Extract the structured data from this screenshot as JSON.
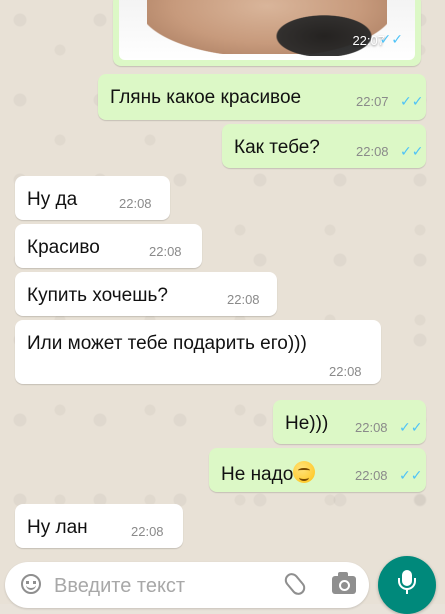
{
  "messages": [
    {
      "text": "Глянь какое красивое",
      "time": "22:07",
      "direction": "out",
      "status": "read"
    },
    {
      "text": "Как тебе?",
      "time": "22:08",
      "direction": "out",
      "status": "read"
    },
    {
      "text": "Ну да",
      "time": "22:08",
      "direction": "in"
    },
    {
      "text": "Красиво",
      "time": "22:08",
      "direction": "in"
    },
    {
      "text": "Купить хочешь?",
      "time": "22:08",
      "direction": "in"
    },
    {
      "text": "Или может тебе подарить его)))",
      "time": "22:08",
      "direction": "in"
    },
    {
      "text": "Не)))",
      "time": "22:08",
      "direction": "out",
      "status": "read"
    },
    {
      "text": "Не надо",
      "time": "22:08",
      "direction": "out",
      "status": "read",
      "emoji": "smirking-face"
    },
    {
      "text": "Ну лан",
      "time": "22:08",
      "direction": "in"
    }
  ],
  "image_message": {
    "time": "22:07",
    "status": "read"
  },
  "composer": {
    "placeholder": "Введите текст"
  },
  "ticks_symbol": "✓✓",
  "colors": {
    "outgoing": "#dcf8c6",
    "incoming": "#ffffff",
    "read_ticks": "#4fc3f7",
    "mic_button": "#00897b"
  }
}
